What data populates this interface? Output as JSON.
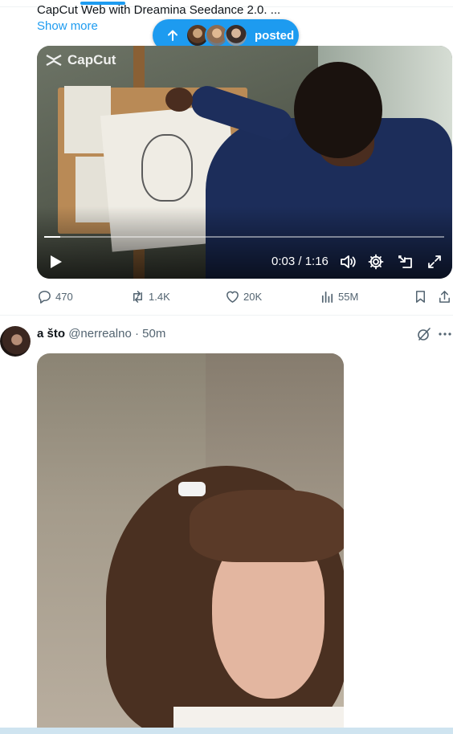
{
  "tweet1": {
    "text_snippet": "CapCut Web with Dreamina Seedance 2.0. ...",
    "show_more": "Show more",
    "video": {
      "watermark": "CapCut",
      "time": "0:03 / 1:16",
      "progress": 0.04
    },
    "actions": {
      "replies": "470",
      "reposts": "1.4K",
      "likes": "20K",
      "views": "55M"
    }
  },
  "new_posts_pill": {
    "label": "posted"
  },
  "tweet2": {
    "display_name": "a što",
    "handle": "@nerrealno",
    "separator": " · ",
    "time": "50m"
  },
  "colors": {
    "accent": "#1d9bf0",
    "muted": "#536471",
    "text": "#0f1419"
  }
}
